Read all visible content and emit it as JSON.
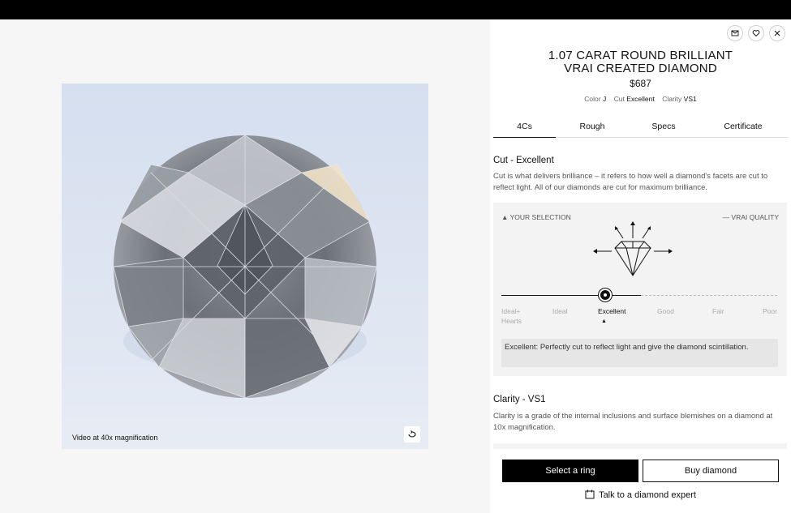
{
  "media": {
    "caption": "Video at 40x magnification",
    "icon": "replay-icon"
  },
  "header_icons": [
    "mail-icon",
    "heart-icon",
    "close-icon"
  ],
  "product": {
    "title_line1": "1.07 CARAT ROUND BRILLIANT",
    "title_line2": "VRAI CREATED DIAMOND",
    "price": "$687",
    "specs": [
      {
        "label": "Color",
        "value": "J"
      },
      {
        "label": "Cut",
        "value": "Excellent"
      },
      {
        "label": "Clarity",
        "value": "VS1"
      }
    ]
  },
  "tabs": [
    "4Cs",
    "Rough",
    "Specs",
    "Certificate"
  ],
  "active_tab": "4Cs",
  "cut": {
    "title": "Cut - Excellent",
    "description": "Cut is what delivers brilliance – it refers to how well a diamond's facets are cut to reflect light. All of our diamonds are cut for maximum brilliance.",
    "your_selection": "YOUR SELECTION",
    "vrai_quality": "VRAI QUALITY",
    "grades": [
      "Ideal+ Hearts",
      "Ideal",
      "Excellent",
      "Good",
      "Fair",
      "Poor"
    ],
    "selected_grade": "Excellent",
    "note": "Excellent: Perfectly cut to reflect light and give the diamond scintillation."
  },
  "clarity": {
    "title": "Clarity - VS1",
    "description": "Clarity is a grade of the internal inclusions and surface blemishes on a diamond at 10x magnification."
  },
  "actions": {
    "select_ring": "Select a ring",
    "buy_diamond": "Buy diamond",
    "talk_expert": "Talk to a diamond expert"
  },
  "colors": {
    "primary": "#000000",
    "background": "#f6f6f6",
    "panel": "#ffffff"
  }
}
